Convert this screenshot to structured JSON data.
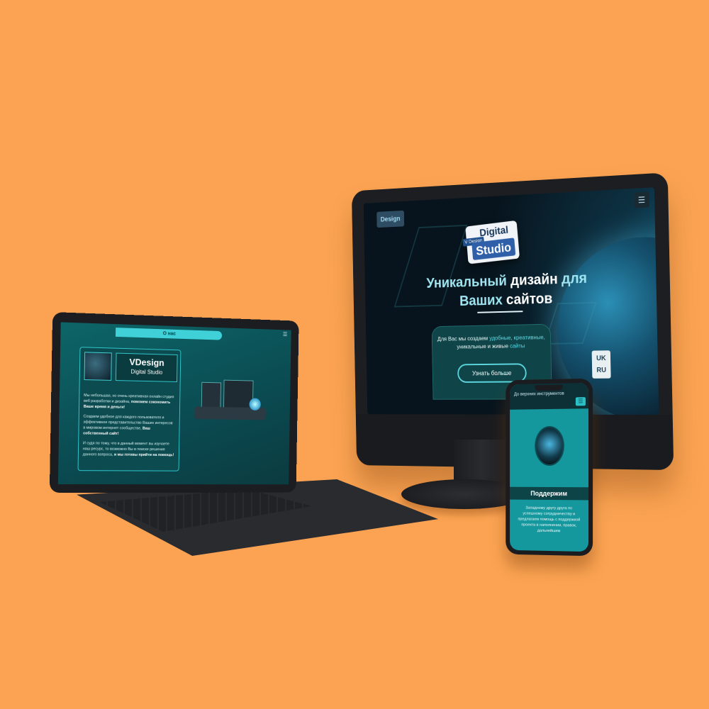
{
  "colors": {
    "background": "#fba352",
    "device_body": "#1d1e21",
    "teal_accent": "#3fd1d7",
    "hero_accent": "#9fe6f2"
  },
  "monitor": {
    "logo_text": "Design",
    "menu_icon": "hamburger-icon",
    "badge_top": "Digital",
    "badge_bottom": "Studio",
    "badge_mini": "V Design",
    "hero_line1_a": "Уникальный ",
    "hero_line1_b": "дизайн",
    "hero_line1_c": " для",
    "hero_line2_a": "Ваших ",
    "hero_line2_b": "сайтов",
    "card_text_a": "Для Вас мы создаем ",
    "card_text_b": "удобные, креативные,",
    "card_text_c": "уникальные и живые ",
    "card_text_d": "сайты",
    "button_label": "Узнать больше",
    "lang_uk": "UK",
    "lang_ru": "RU"
  },
  "laptop": {
    "tab_label": "О нас",
    "menu_icon": "hamburger-icon",
    "brand_title": "VDesign",
    "brand_subtitle": "Digital Studio",
    "para1_a": "Мы небольшая, но очень креативная онлайн студия веб разработки и дизайна, ",
    "para1_b": "поможем сэкономить Ваше время и деньги!",
    "para2_a": "Создаем удобное для каждого пользователя и эффективное представительство Ваших интересов в мировом интернет сообществе, ",
    "para2_b": "Ваш собственный сайт!",
    "para3_a": "И судя по тому, что в данный момент вы изучаете наш ресурс, то возможно Вы в поиске решения данного вопроса, ",
    "para3_b": "и мы готовы прийти на помощь!"
  },
  "phone": {
    "top_text": "До верхних инструментов",
    "menu_icon": "hamburger-icon",
    "heading": "Поддержим",
    "body": "Западному другу друга по успешному сотрудничеству и предлагаем помощь с поддержкой проекта в наполнении, правок, дальнейшим"
  }
}
